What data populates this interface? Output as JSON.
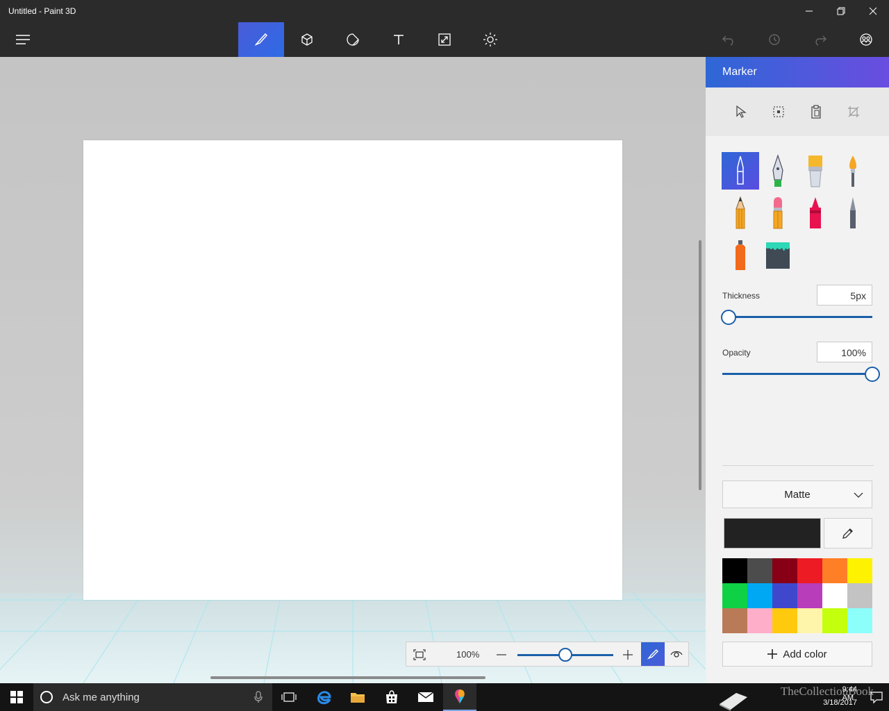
{
  "window": {
    "title": "Untitled - Paint 3D"
  },
  "toolbar": {
    "tools": [
      {
        "icon": "brush-icon",
        "active": true
      },
      {
        "icon": "3d-cube-icon",
        "active": false
      },
      {
        "icon": "stickers-icon",
        "active": false
      },
      {
        "icon": "text-icon",
        "active": false
      },
      {
        "icon": "canvas-resize-icon",
        "active": false
      },
      {
        "icon": "effects-icon",
        "active": false
      }
    ],
    "right_icons": [
      "undo-icon",
      "history-icon",
      "redo-icon",
      "community-icon"
    ]
  },
  "panel": {
    "title": "Marker",
    "tools": [
      "select-icon",
      "select-region-icon",
      "paste-icon",
      "crop-icon"
    ],
    "brushes": [
      {
        "name": "marker",
        "active": true
      },
      {
        "name": "calligraphy-pen"
      },
      {
        "name": "oil-brush"
      },
      {
        "name": "watercolor"
      },
      {
        "name": "pencil"
      },
      {
        "name": "eraser"
      },
      {
        "name": "crayon"
      },
      {
        "name": "pixel-pen"
      },
      {
        "name": "spray-can"
      },
      {
        "name": "fill-bucket"
      }
    ],
    "thickness_label": "Thickness",
    "thickness_value": "5px",
    "thickness_fraction": 0.04,
    "opacity_label": "Opacity",
    "opacity_value": "100%",
    "opacity_fraction": 1.0,
    "finish": "Matte",
    "current_color": "#222222",
    "palette": [
      "#000000",
      "#4c4c4c",
      "#880015",
      "#ed1c24",
      "#ff7f27",
      "#fff200",
      "#0ed145",
      "#00a8f3",
      "#3f48cc",
      "#b83dba",
      "#ffffff",
      "#c3c3c3",
      "#b97a57",
      "#ffaec9",
      "#ffc90e",
      "#fff5aa",
      "#c4ff0e",
      "#8cfffb"
    ],
    "add_color_label": "Add color"
  },
  "zoom": {
    "level": "100%",
    "fraction": 0.5
  },
  "taskbar": {
    "search_placeholder": "Ask me anything",
    "time": "9:44 AM",
    "date": "3/18/2017",
    "watermark": "TheCollectionBook"
  }
}
